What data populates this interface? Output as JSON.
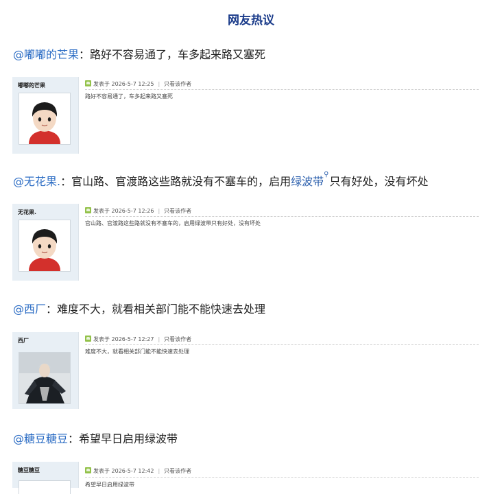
{
  "page": {
    "title": "网友热议"
  },
  "comments": [
    {
      "user": "@嘟嘟的芒果",
      "sep": "：",
      "text": "路好不容易通了，车多起来路又塞死",
      "post": {
        "username": "嘟嘟的芒果",
        "posted_at": "发表于 2026-5-7 12:25",
        "only_author": "只看该作者",
        "body": "路好不容易通了，车多起来路又塞死"
      }
    },
    {
      "user": "@无花果.",
      "sep": "：",
      "text_before": "官山路、官渡路这些路就没有不塞车的，启用",
      "link": "绿波带",
      "text_after": "只有好处，没有坏处",
      "post": {
        "username": "无花果.",
        "posted_at": "发表于 2026-5-7 12:26",
        "only_author": "只看该作者",
        "body": "官山路、官渡路这些路就没有不塞车的，启用绿波带只有好处，没有坏处"
      }
    },
    {
      "user": "@西厂",
      "sep": "：",
      "text": "难度不大，就看相关部门能不能快速去处理",
      "post": {
        "username": "西厂",
        "posted_at": "发表于 2026-5-7 12:27",
        "only_author": "只看该作者",
        "body": "难度不大，就看相关部门能不能快速去处理"
      }
    },
    {
      "user": "@糖豆糖豆",
      "sep": "：",
      "text": "希望早日启用绿波带",
      "post": {
        "username": "糖豆糖豆",
        "posted_at": "发表于 2026-5-7 12:42",
        "only_author": "只看该作者",
        "body": "希望早日启用绿波带"
      }
    }
  ]
}
